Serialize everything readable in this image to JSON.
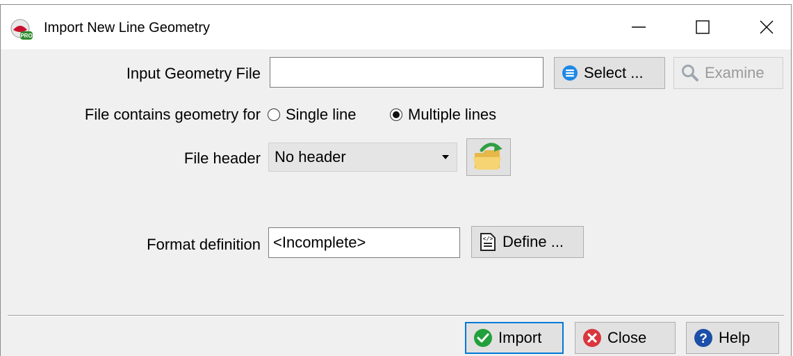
{
  "window": {
    "title": "Import New Line Geometry",
    "icon_name": "app-logo-pro-icon",
    "controls": [
      "minimize-icon",
      "maximize-icon",
      "close-icon"
    ]
  },
  "input_geometry": {
    "label": "Input Geometry File",
    "value": "",
    "select_label": "Select ...",
    "select_icon": "list-icon",
    "examine_label": "Examine",
    "examine_icon": "magnifier-icon",
    "examine_enabled": false
  },
  "geometry_scope": {
    "label": "File contains geometry for",
    "options": [
      {
        "label": "Single line",
        "checked": false
      },
      {
        "label": "Multiple lines",
        "checked": true
      }
    ]
  },
  "file_header": {
    "label": "File header",
    "selected": "No header",
    "load_icon": "folder-arrow-icon"
  },
  "format_definition": {
    "label": "Format definition",
    "value": "<Incomplete>",
    "define_label": "Define ...",
    "define_icon": "document-edit-icon"
  },
  "footer": {
    "import_label": "Import",
    "close_label": "Close",
    "help_label": "Help"
  },
  "colors": {
    "accent": "#0078d7",
    "ok_green": "#22a03c",
    "close_red": "#d9363e",
    "help_blue": "#1c4fa8"
  }
}
